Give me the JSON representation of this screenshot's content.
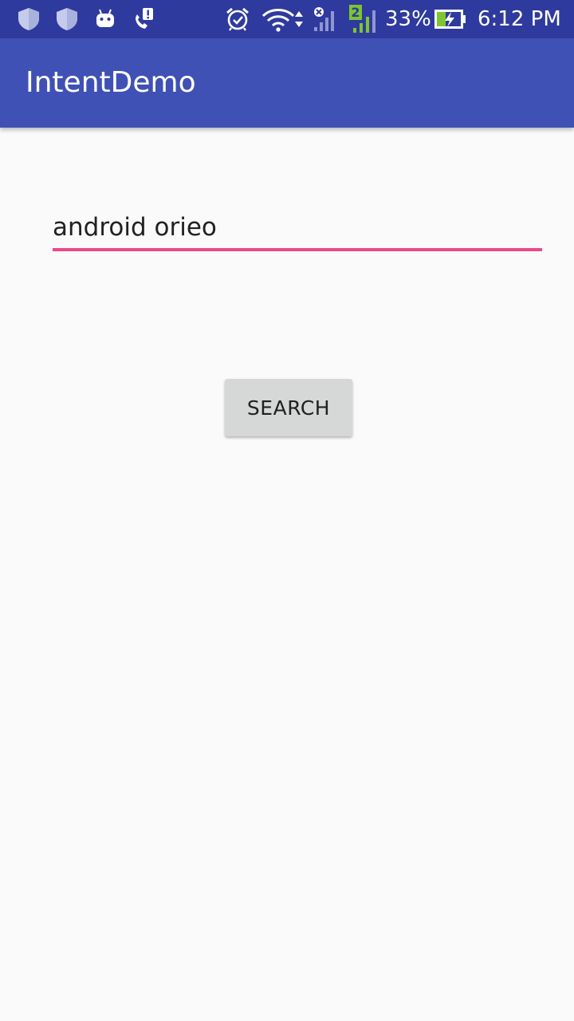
{
  "status_bar": {
    "icons": [
      "shield-icon",
      "shield-icon",
      "android-icon",
      "phone-alert-icon",
      "alarm-icon",
      "wifi-icon",
      "signal-icon",
      "sim2-signal-icon",
      "battery-charging-icon"
    ],
    "sim_label": "2",
    "battery": "33%",
    "time": "6:12 PM",
    "colors": {
      "background": "#2f3a9e",
      "sim2_accent": "#7cc62f"
    }
  },
  "app_bar": {
    "title": "IntentDemo",
    "color": "#3f51b5"
  },
  "search": {
    "value": "android orieo",
    "underline_color": "#e94a8a"
  },
  "search_button": {
    "label": "SEARCH"
  }
}
